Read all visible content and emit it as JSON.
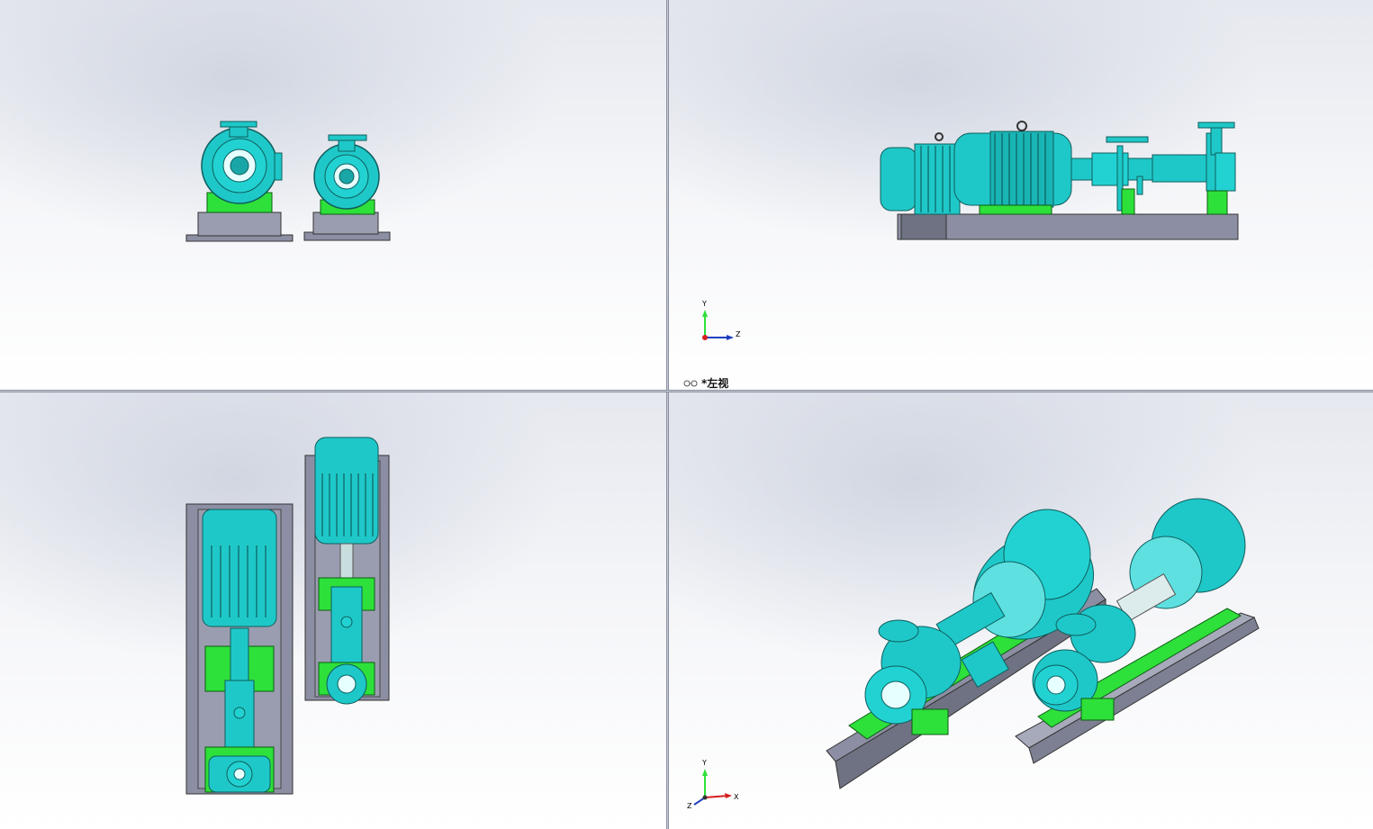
{
  "viewports": {
    "top_left": {
      "name": "front-view"
    },
    "top_right": {
      "name": "left-view",
      "label": "*左视"
    },
    "bottom_left": {
      "name": "top-view"
    },
    "bottom_right": {
      "name": "isometric-view"
    }
  },
  "triad_left_view": {
    "axis_y": "Y",
    "axis_z": "Z"
  },
  "triad_iso_view": {
    "axis_y": "Y",
    "axis_x": "X",
    "axis_z": "Z"
  },
  "colors": {
    "pump_body": "#1fc8c8",
    "pump_dark": "#0f7d7d",
    "support_green": "#2ee03a",
    "baseplate_gray": "#8c8fa3",
    "background_top": "#e6e8ef"
  }
}
